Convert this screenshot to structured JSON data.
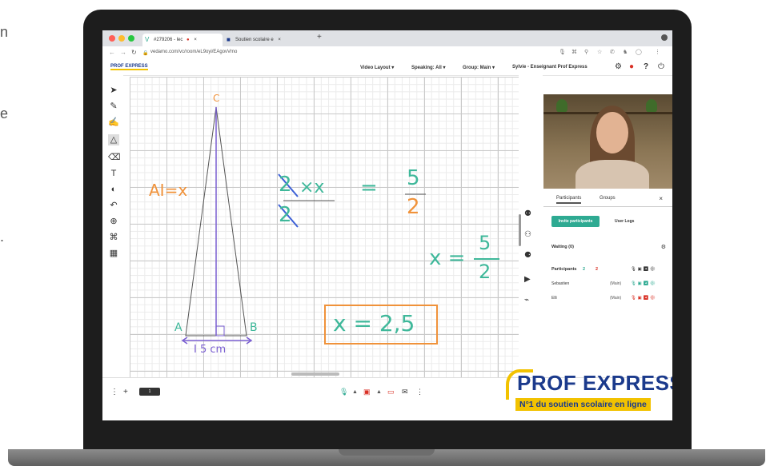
{
  "side_text": [
    "n",
    "e",
    "."
  ],
  "browser": {
    "tabs": [
      {
        "label": "#279206 - lec",
        "active": true
      },
      {
        "label": "Soutien scolaire e",
        "active": false
      }
    ],
    "new_tab": "+",
    "url": "vedamo.com/vc/room/eL9oyi/EAgovVmo"
  },
  "app": {
    "logo": "PROF EXPRESS",
    "menu": [
      "Video Layout ▾",
      "Speaking: All ▾",
      "Group: Main ▾",
      "Sylvie - Enseignant Prof Express"
    ]
  },
  "whiteboard": {
    "vertex_top": "C",
    "vertex_left": "A",
    "vertex_right": "B",
    "label_ai": "AI=x",
    "base_label": "I 5 cm",
    "eq1_left_num": "2",
    "eq1_times": "×x",
    "eq1_left_den": "2",
    "eq1_equals": "=",
    "eq1_right_num": "5",
    "eq1_right_den": "2",
    "eq2_left": "x =",
    "eq2_num": "5",
    "eq2_den": "2",
    "eq3": "x = 2,5"
  },
  "panel": {
    "tabs": [
      "Participants",
      "Groups"
    ],
    "close": "×",
    "invite": "Invite participants",
    "user_logs": "User Logs",
    "waiting": "Waiting (0)",
    "participants_label": "Participants",
    "count_green": "2",
    "count_red": "2",
    "rows": [
      {
        "name": "Sebastien",
        "role": "(Main)"
      },
      {
        "name": "Elli",
        "role": "(Main)"
      }
    ]
  },
  "bottom": {
    "page": "1"
  },
  "brand": {
    "name": "PROF EXPRESS",
    "tagline": "N°1 du soutien scolaire en ligne"
  },
  "colors": {
    "accent_teal": "#2eaa92",
    "brand_blue": "#1b3a8c",
    "brand_yellow": "#f2c200",
    "pen_orange": "#f0923a",
    "pen_purple": "#7a5fd1",
    "pen_teal": "#3fb89a"
  }
}
